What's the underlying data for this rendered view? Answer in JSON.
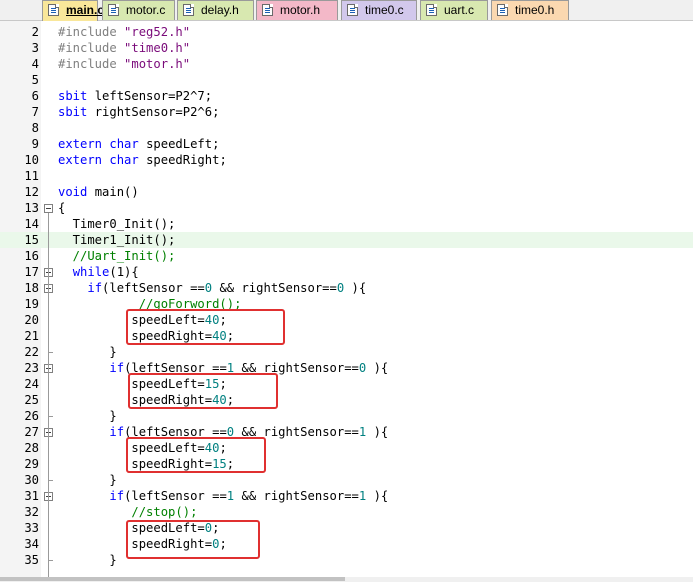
{
  "tabs": [
    {
      "label": "main.c",
      "color": "#f9e79a",
      "active": true
    },
    {
      "label": "motor.c",
      "color": "#d8e8b0",
      "active": false
    },
    {
      "label": "delay.h",
      "color": "#d8e8b0",
      "active": false
    },
    {
      "label": "motor.h",
      "color": "#f3b8c8",
      "active": false
    },
    {
      "label": "time0.c",
      "color": "#d2c8ec",
      "active": false
    },
    {
      "label": "uart.c",
      "color": "#d8e8b0",
      "active": false
    },
    {
      "label": "time0.h",
      "color": "#fbd8b0",
      "active": false
    }
  ],
  "lines": [
    {
      "n": "2",
      "segs": [
        [
          "pp",
          "#include "
        ],
        [
          "str",
          "\"reg52.h\""
        ]
      ]
    },
    {
      "n": "3",
      "segs": [
        [
          "pp",
          "#include "
        ],
        [
          "str",
          "\"time0.h\""
        ]
      ]
    },
    {
      "n": "4",
      "segs": [
        [
          "pp",
          "#include "
        ],
        [
          "str",
          "\"motor.h\""
        ]
      ]
    },
    {
      "n": "5",
      "segs": []
    },
    {
      "n": "6",
      "segs": [
        [
          "kw",
          "sbit"
        ],
        [
          "",
          " leftSensor=P2^7;"
        ]
      ]
    },
    {
      "n": "7",
      "segs": [
        [
          "kw",
          "sbit"
        ],
        [
          "",
          " rightSensor=P2^6;"
        ]
      ]
    },
    {
      "n": "8",
      "segs": []
    },
    {
      "n": "9",
      "segs": [
        [
          "kw",
          "extern"
        ],
        [
          "",
          " "
        ],
        [
          "kw",
          "char"
        ],
        [
          "",
          " speedLeft;"
        ]
      ]
    },
    {
      "n": "10",
      "segs": [
        [
          "kw",
          "extern"
        ],
        [
          "",
          " "
        ],
        [
          "kw",
          "char"
        ],
        [
          "",
          " speedRight;"
        ]
      ]
    },
    {
      "n": "11",
      "segs": []
    },
    {
      "n": "12",
      "segs": [
        [
          "kw",
          "void"
        ],
        [
          "",
          " main()"
        ]
      ]
    },
    {
      "n": "13",
      "segs": [
        [
          "",
          "{"
        ]
      ],
      "fold": true
    },
    {
      "n": "14",
      "segs": [
        [
          "",
          "  Timer0_Init();"
        ]
      ]
    },
    {
      "n": "15",
      "segs": [
        [
          "",
          "  Timer1_Init();"
        ]
      ],
      "highlight": true
    },
    {
      "n": "16",
      "segs": [
        [
          "cmt",
          "  //Uart_Init();"
        ]
      ]
    },
    {
      "n": "17",
      "segs": [
        [
          "",
          "  "
        ],
        [
          "kw",
          "while"
        ],
        [
          "",
          "(1){"
        ]
      ],
      "fold": true
    },
    {
      "n": "18",
      "segs": [
        [
          "",
          "    "
        ],
        [
          "kw",
          "if"
        ],
        [
          "",
          "(leftSensor =="
        ],
        [
          "num",
          "0"
        ],
        [
          "",
          " && rightSensor=="
        ],
        [
          "num",
          "0"
        ],
        [
          "",
          " ){"
        ]
      ],
      "fold": true
    },
    {
      "n": "19",
      "segs": [
        [
          "cmt",
          "           //goForword();"
        ]
      ]
    },
    {
      "n": "20",
      "segs": [
        [
          "",
          "          speedLeft="
        ],
        [
          "num",
          "40"
        ],
        [
          "",
          ";"
        ]
      ]
    },
    {
      "n": "21",
      "segs": [
        [
          "",
          "          speedRight="
        ],
        [
          "num",
          "40"
        ],
        [
          "",
          ";"
        ]
      ]
    },
    {
      "n": "22",
      "segs": [
        [
          "",
          "       }"
        ]
      ],
      "foldEnd": true
    },
    {
      "n": "23",
      "segs": [
        [
          "",
          "       "
        ],
        [
          "kw",
          "if"
        ],
        [
          "",
          "(leftSensor =="
        ],
        [
          "num",
          "1"
        ],
        [
          "",
          " && rightSensor=="
        ],
        [
          "num",
          "0"
        ],
        [
          "",
          " ){"
        ]
      ],
      "fold": true
    },
    {
      "n": "24",
      "segs": [
        [
          "",
          "          speedLeft="
        ],
        [
          "num",
          "15"
        ],
        [
          "",
          ";"
        ]
      ]
    },
    {
      "n": "25",
      "segs": [
        [
          "",
          "          speedRight="
        ],
        [
          "num",
          "40"
        ],
        [
          "",
          ";"
        ]
      ]
    },
    {
      "n": "26",
      "segs": [
        [
          "",
          "       }"
        ]
      ],
      "foldEnd": true
    },
    {
      "n": "27",
      "segs": [
        [
          "",
          "       "
        ],
        [
          "kw",
          "if"
        ],
        [
          "",
          "(leftSensor =="
        ],
        [
          "num",
          "0"
        ],
        [
          "",
          " && rightSensor=="
        ],
        [
          "num",
          "1"
        ],
        [
          "",
          " ){"
        ]
      ],
      "fold": true
    },
    {
      "n": "28",
      "segs": [
        [
          "",
          "          speedLeft="
        ],
        [
          "num",
          "40"
        ],
        [
          "",
          ";"
        ]
      ]
    },
    {
      "n": "29",
      "segs": [
        [
          "",
          "          speedRight="
        ],
        [
          "num",
          "15"
        ],
        [
          "",
          ";"
        ]
      ]
    },
    {
      "n": "30",
      "segs": [
        [
          "",
          "       }"
        ]
      ],
      "foldEnd": true
    },
    {
      "n": "31",
      "segs": [
        [
          "",
          "       "
        ],
        [
          "kw",
          "if"
        ],
        [
          "",
          "(leftSensor =="
        ],
        [
          "num",
          "1"
        ],
        [
          "",
          " && rightSensor=="
        ],
        [
          "num",
          "1"
        ],
        [
          "",
          " ){"
        ]
      ],
      "fold": true
    },
    {
      "n": "32",
      "segs": [
        [
          "cmt",
          "          //stop();"
        ]
      ]
    },
    {
      "n": "33",
      "segs": [
        [
          "",
          "          speedLeft="
        ],
        [
          "num",
          "0"
        ],
        [
          "",
          ";"
        ]
      ]
    },
    {
      "n": "34",
      "segs": [
        [
          "",
          "          speedRight="
        ],
        [
          "num",
          "0"
        ],
        [
          "",
          ";"
        ]
      ]
    },
    {
      "n": "35",
      "segs": [
        [
          "",
          "       }"
        ]
      ],
      "foldEnd": true
    }
  ]
}
